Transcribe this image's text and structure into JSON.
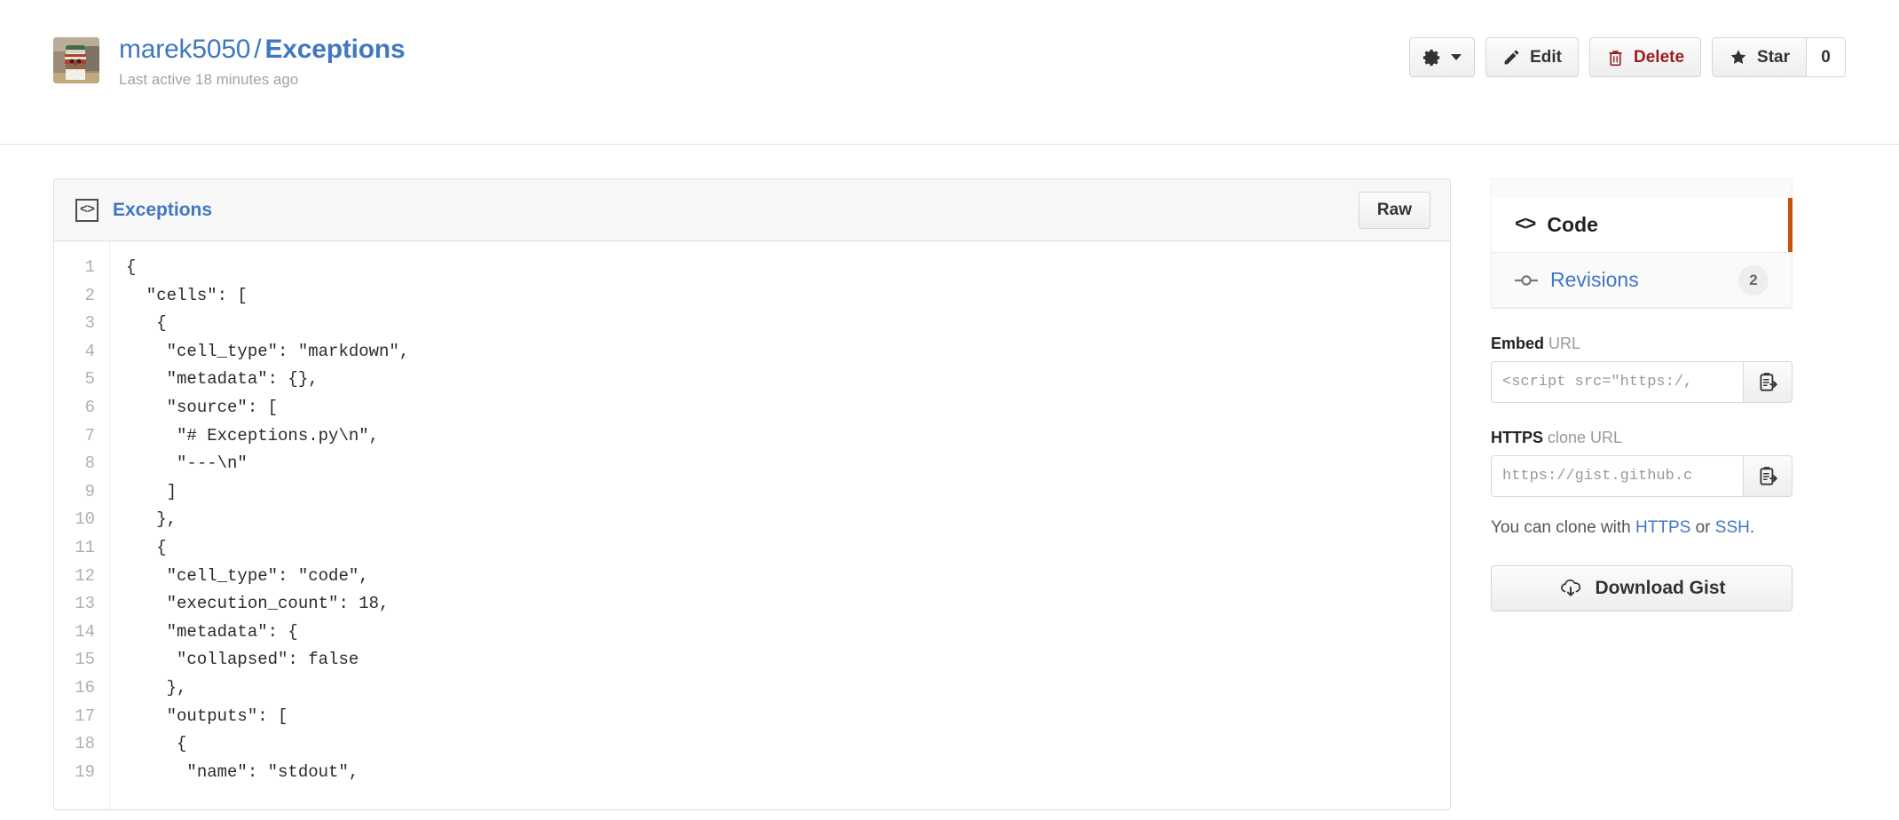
{
  "header": {
    "owner": "marek5050",
    "separator": "/",
    "gist_name": "Exceptions",
    "last_active": "Last active 18 minutes ago",
    "avatar_alt": "avatar",
    "actions": {
      "gear_label": "",
      "edit_label": "Edit",
      "delete_label": "Delete",
      "star_label": "Star",
      "star_count": "0"
    }
  },
  "file": {
    "name": "Exceptions",
    "raw_label": "Raw",
    "line_numbers": [
      "1",
      "2",
      "3",
      "4",
      "5",
      "6",
      "7",
      "8",
      "9",
      "10",
      "11",
      "12",
      "13",
      "14",
      "15",
      "16",
      "17",
      "18",
      "19"
    ],
    "code": [
      "{",
      "  \"cells\": [",
      "   {",
      "    \"cell_type\": \"markdown\",",
      "    \"metadata\": {},",
      "    \"source\": [",
      "     \"# Exceptions.py\\n\",",
      "     \"---\\n\"",
      "    ]",
      "   },",
      "   {",
      "    \"cell_type\": \"code\",",
      "    \"execution_count\": 18,",
      "    \"metadata\": {",
      "     \"collapsed\": false",
      "    },",
      "    \"outputs\": [",
      "     {",
      "      \"name\": \"stdout\","
    ]
  },
  "sidebar": {
    "tabs": [
      {
        "label": "Code",
        "count": "",
        "active": true
      },
      {
        "label": "Revisions",
        "count": "2",
        "active": false
      }
    ],
    "embed": {
      "label_strong": "Embed",
      "label_rest": " URL",
      "value": "<script src=\"https:/,"
    },
    "clone": {
      "label_strong": "HTTPS",
      "label_rest": " clone URL",
      "value": "https://gist.github.c"
    },
    "clone_note": {
      "prefix": "You can clone with ",
      "https_link": "HTTPS",
      "middle": " or ",
      "ssh_link": "SSH",
      "suffix": "."
    },
    "download_label": "Download Gist"
  },
  "colors": {
    "link_blue": "#4078c0",
    "delete_red": "#9b1c1c",
    "active_tab_orange": "#c9510c",
    "muted_gray": "#999999"
  }
}
